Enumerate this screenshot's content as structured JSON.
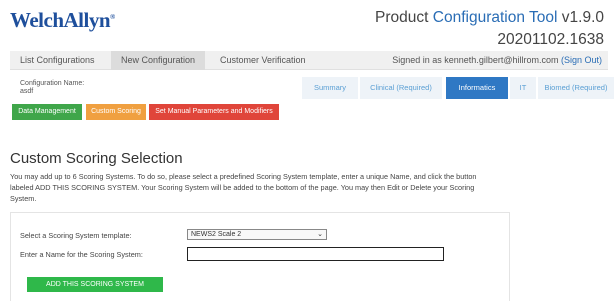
{
  "header": {
    "logo": "WelchAllyn",
    "logo_mark": "®",
    "title_prefix": "Product",
    "title_highlight": "Configuration Tool",
    "title_version": "v1.9.0",
    "build": "20201102.1638"
  },
  "topnav": {
    "tabs": [
      {
        "label": "List Configurations"
      },
      {
        "label": "New Configuration"
      },
      {
        "label": "Customer Verification"
      }
    ],
    "active_tab": "New Configuration",
    "signed_in_text": "Signed in as kenneth.gilbert@hillrom.com",
    "sign_out": "(Sign Out)"
  },
  "config": {
    "label": "Configuration Name:",
    "value": "asdf"
  },
  "subtabs": [
    {
      "label": "Summary"
    },
    {
      "label": "Clinical (Required)"
    },
    {
      "label": "Informatics"
    },
    {
      "label": "IT"
    },
    {
      "label": "Biomed (Required)"
    }
  ],
  "active_subtab": "Informatics",
  "actions": [
    {
      "label": "Data Management"
    },
    {
      "label": "Custom Scoring"
    },
    {
      "label": "Set Manual Parameters and Modifiers"
    }
  ],
  "colors": {
    "brand_blue": "#1e4f9c",
    "active_tab": "#2f78c4",
    "green": "#3fa64a",
    "orange": "#f0a040",
    "red": "#e0453a"
  },
  "main": {
    "title": "Custom Scoring Selection",
    "intro": "You may add up to 6 Scoring Systems. To do so, please select a predefined Scoring System template, enter a unique Name, and click the button labeled ADD THIS SCORING SYSTEM. Your Scoring System will be added to the bottom of the page. You may then Edit or Delete your Scoring System.",
    "template_label": "Select a Scoring System template:",
    "template_value": "NEWS2 Scale 2",
    "name_label": "Enter a Name for the Scoring System:",
    "name_value": "",
    "add_button": "ADD THIS SCORING SYSTEM"
  }
}
